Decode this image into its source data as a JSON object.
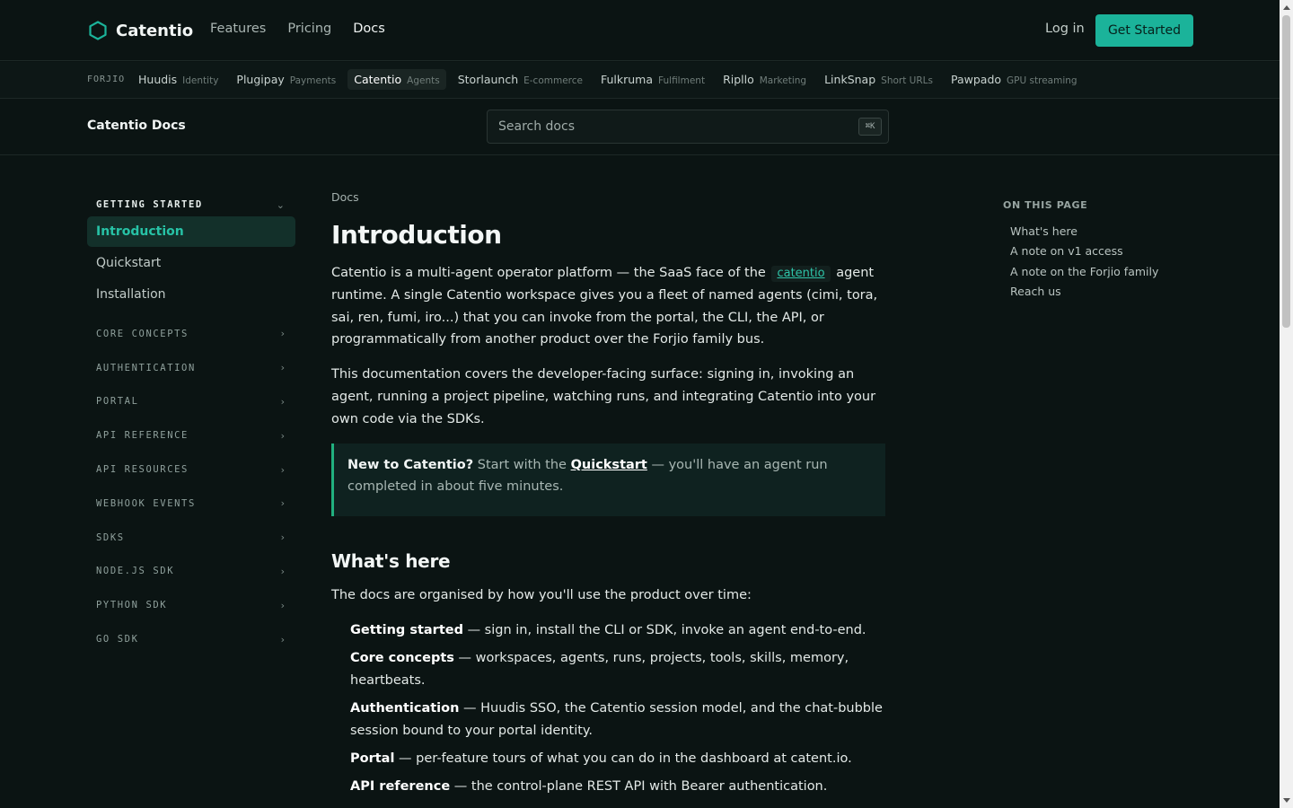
{
  "brand": {
    "name": "Catentio",
    "accent": "#1bb39a"
  },
  "nav": {
    "links": [
      {
        "label": "Features",
        "active": false
      },
      {
        "label": "Pricing",
        "active": false
      },
      {
        "label": "Docs",
        "active": true
      }
    ],
    "login_label": "Log in",
    "cta_label": "Get Started"
  },
  "family": {
    "label": "FORJIO",
    "items": [
      {
        "name": "Huudis",
        "desc": "Identity",
        "active": false
      },
      {
        "name": "Plugipay",
        "desc": "Payments",
        "active": false
      },
      {
        "name": "Catentio",
        "desc": "Agents",
        "active": true
      },
      {
        "name": "Storlaunch",
        "desc": "E-commerce",
        "active": false
      },
      {
        "name": "Fulkruma",
        "desc": "Fulfilment",
        "active": false
      },
      {
        "name": "Ripllo",
        "desc": "Marketing",
        "active": false
      },
      {
        "name": "LinkSnap",
        "desc": "Short URLs",
        "active": false
      },
      {
        "name": "Pawpado",
        "desc": "GPU streaming",
        "active": false
      }
    ]
  },
  "docs_bar": {
    "title": "Catentio Docs",
    "search_placeholder": "Search docs",
    "search_shortcut": "⌘K"
  },
  "sidebar": {
    "open_section": {
      "label": "GETTING STARTED",
      "items": [
        {
          "label": "Introduction",
          "active": true
        },
        {
          "label": "Quickstart",
          "active": false
        },
        {
          "label": "Installation",
          "active": false
        }
      ]
    },
    "sections": [
      "CORE CONCEPTS",
      "AUTHENTICATION",
      "PORTAL",
      "API REFERENCE",
      "API RESOURCES",
      "WEBHOOK EVENTS",
      "SDKS",
      "NODE.JS SDK",
      "PYTHON SDK",
      "GO SDK"
    ]
  },
  "main": {
    "breadcrumb": "Docs",
    "title": "Introduction",
    "para1": {
      "before": "Catentio is a multi-agent operator platform — the SaaS face of the",
      "code": "catentio",
      "after": "agent runtime. A single Catentio workspace gives you a fleet of named agents (cimi, tora, sai, ren, fumi, iro...) that you can invoke from the portal, the CLI, the API, or programmatically from another product over the Forjio family bus."
    },
    "para2": "This documentation covers the developer-facing surface: signing in, invoking an agent, running a project pipeline, watching runs, and integrating Catentio into your own code via the SDKs.",
    "callout": {
      "strong": "New to Catentio?",
      "before": "Start with the",
      "link": "Quickstart",
      "after": "— you'll have an agent run completed in about five minutes."
    },
    "h2": "What's here",
    "intro": "The docs are organised by how you'll use the product over time:",
    "list": [
      {
        "term": "Getting started",
        "desc": "— sign in, install the CLI or SDK, invoke an agent end-to-end."
      },
      {
        "term": "Core concepts",
        "desc": "— workspaces, agents, runs, projects, tools, skills, memory, heartbeats."
      },
      {
        "term": "Authentication",
        "desc": "— Huudis SSO, the Catentio session model, and the chat-bubble session bound to your portal identity."
      },
      {
        "term": "Portal",
        "desc": "— per-feature tours of what you can do in the dashboard at catent.io."
      },
      {
        "term": "API reference",
        "desc": "— the control-plane REST API with Bearer authentication."
      }
    ]
  },
  "toc": {
    "title": "ON THIS PAGE",
    "links": [
      "What's here",
      "A note on v1 access",
      "A note on the Forjio family",
      "Reach us"
    ]
  }
}
